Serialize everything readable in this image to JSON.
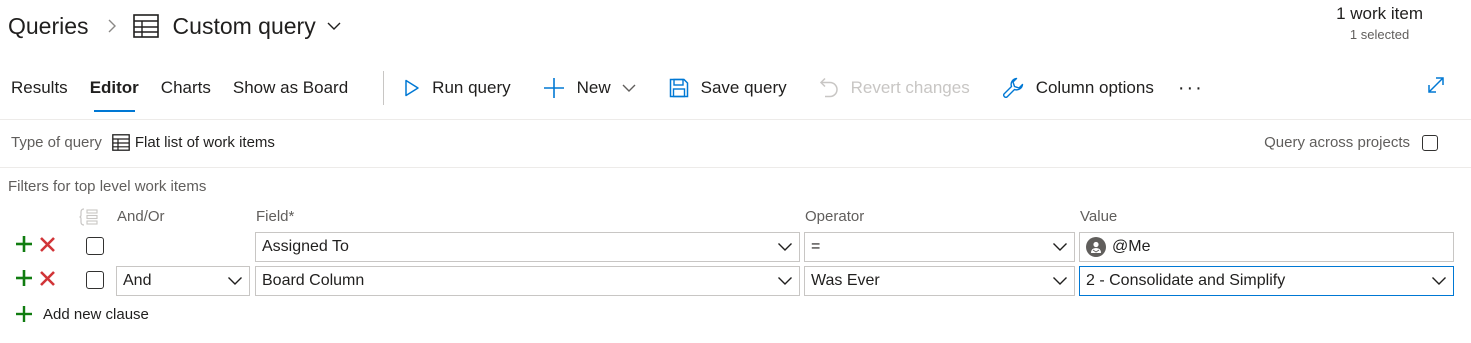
{
  "header": {
    "breadcrumb_root": "Queries",
    "title": "Custom query",
    "item_count": "1 work item",
    "selected": "1 selected"
  },
  "tabs": [
    {
      "label": "Results"
    },
    {
      "label": "Editor"
    },
    {
      "label": "Charts"
    },
    {
      "label": "Show as Board"
    }
  ],
  "toolbar": {
    "run_query": "Run query",
    "new": "New",
    "save_query": "Save query",
    "revert_changes": "Revert changes",
    "column_options": "Column options",
    "more": "···"
  },
  "query_type": {
    "label": "Type of query",
    "value": "Flat list of work items"
  },
  "query_across_projects": {
    "label": "Query across projects",
    "checked": false
  },
  "filters": {
    "title": "Filters for top level work items",
    "columns": {
      "andor": "And/Or",
      "field": "Field*",
      "operator": "Operator",
      "value": "Value"
    },
    "rows": [
      {
        "andor": "",
        "field": "Assigned To",
        "operator": "=",
        "value": "@Me"
      },
      {
        "andor": "And",
        "field": "Board Column",
        "operator": "Was Ever",
        "value": "2 - Consolidate and Simplify"
      }
    ],
    "add_clause": "Add new clause"
  },
  "colors": {
    "accent": "#0078d4",
    "add_green": "#107c10",
    "delete_red": "#d13438",
    "disabled": "#c8c6c4"
  },
  "icons": {
    "breadcrumb_separator": "chevron-right-icon",
    "query_type": "table-grid-icon",
    "run": "play-icon",
    "new": "plus-icon",
    "save": "save-icon",
    "revert": "undo-icon",
    "column_options": "wrench-icon",
    "expand": "expand-icon",
    "add_row": "plus-icon",
    "delete_row": "close-icon"
  }
}
